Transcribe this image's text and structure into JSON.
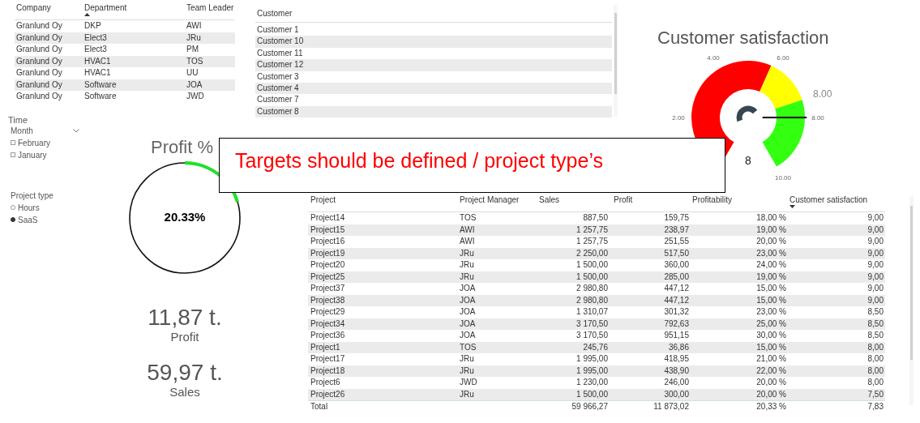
{
  "team_table": {
    "ascending": true,
    "columns": [
      {
        "label": "Company",
        "sorted": false
      },
      {
        "label": "Department",
        "sorted": true
      },
      {
        "label": "Team Leader",
        "sorted": false
      }
    ],
    "rows": [
      [
        "Granlund Oy",
        "DKP",
        "AWI"
      ],
      [
        "Granlund Oy",
        "Elect3",
        "JRu"
      ],
      [
        "Granlund Oy",
        "Elect3",
        "PM"
      ],
      [
        "Granlund Oy",
        "HVAC1",
        "TOS"
      ],
      [
        "Granlund Oy",
        "HVAC1",
        "UU"
      ],
      [
        "Granlund Oy",
        "Software",
        "JOA"
      ],
      [
        "Granlund Oy",
        "Software",
        "JWD"
      ]
    ]
  },
  "customer_slicer": {
    "header": "Customer",
    "items": [
      "Customer 1",
      "Customer 10",
      "Customer 11",
      "Customer 12",
      "Customer 3",
      "Customer 4",
      "Customer 7",
      "Customer 8"
    ]
  },
  "satisfaction_gauge": {
    "title": "Customer satisfaction",
    "ticks": [
      "2.00",
      "4.00",
      "6.00",
      "8.00",
      "10.00"
    ],
    "value_label": "8.00",
    "value": "8"
  },
  "time_slicer": {
    "title": "Time",
    "dropdown": "Month",
    "items": [
      {
        "label": "February",
        "checked": false
      },
      {
        "label": "January",
        "checked": false
      }
    ]
  },
  "project_type_slicer": {
    "title": "Project type",
    "options": [
      {
        "label": "Hours",
        "selected": false
      },
      {
        "label": "SaaS",
        "selected": true
      }
    ]
  },
  "profit_gauge": {
    "title": "Profit %",
    "value": "20.33%"
  },
  "cards": [
    {
      "value": "11,87 t.",
      "label": "Profit"
    },
    {
      "value": "59,97 t.",
      "label": "Sales"
    }
  ],
  "callout": {
    "text": "Targets should be defined / project type’s"
  },
  "projects_table": {
    "ascending": false,
    "columns": [
      {
        "label": "Project",
        "sorted": false
      },
      {
        "label": "Project Manager",
        "sorted": false
      },
      {
        "label": "Sales",
        "sorted": false
      },
      {
        "label": "Profit",
        "sorted": false
      },
      {
        "label": "Profitability",
        "sorted": false
      },
      {
        "label": "Customer satisfaction",
        "sorted": true
      }
    ],
    "rows": [
      [
        "Project14",
        "TOS",
        "887,50",
        "159,75",
        "18,00 %",
        "9,00"
      ],
      [
        "Project15",
        "AWI",
        "1 257,75",
        "238,97",
        "19,00 %",
        "9,00"
      ],
      [
        "Project16",
        "AWI",
        "1 257,75",
        "251,55",
        "20,00 %",
        "9,00"
      ],
      [
        "Project19",
        "JRu",
        "2 250,00",
        "517,50",
        "23,00 %",
        "9,00"
      ],
      [
        "Project20",
        "JRu",
        "1 500,00",
        "360,00",
        "24,00 %",
        "9,00"
      ],
      [
        "Project25",
        "JRu",
        "1 500,00",
        "285,00",
        "19,00 %",
        "9,00"
      ],
      [
        "Project37",
        "JOA",
        "2 980,80",
        "447,12",
        "15,00 %",
        "9,00"
      ],
      [
        "Project38",
        "JOA",
        "2 980,80",
        "447,12",
        "15,00 %",
        "9,00"
      ],
      [
        "Project29",
        "JOA",
        "1 310,07",
        "301,32",
        "23,00 %",
        "8,50"
      ],
      [
        "Project34",
        "JOA",
        "3 170,50",
        "792,63",
        "25,00 %",
        "8,50"
      ],
      [
        "Project36",
        "JOA",
        "3 170,50",
        "951,15",
        "30,00 %",
        "8,50"
      ],
      [
        "Project1",
        "TOS",
        "245,76",
        "36,86",
        "15,00 %",
        "8,00"
      ],
      [
        "Project17",
        "JRu",
        "1 995,00",
        "418,95",
        "21,00 %",
        "8,00"
      ],
      [
        "Project18",
        "JRu",
        "1 995,00",
        "438,90",
        "22,00 %",
        "8,00"
      ],
      [
        "Project6",
        "JWD",
        "1 230,00",
        "246,00",
        "20,00 %",
        "8,00"
      ],
      [
        "Project26",
        "JRu",
        "1 500,00",
        "300,00",
        "20,00 %",
        "7,50"
      ]
    ],
    "total": {
      "label": "Total",
      "sales": "59 966,27",
      "profit": "11 873,02",
      "profitability": "20,33 %",
      "customer_satisfaction": "7,83"
    }
  }
}
